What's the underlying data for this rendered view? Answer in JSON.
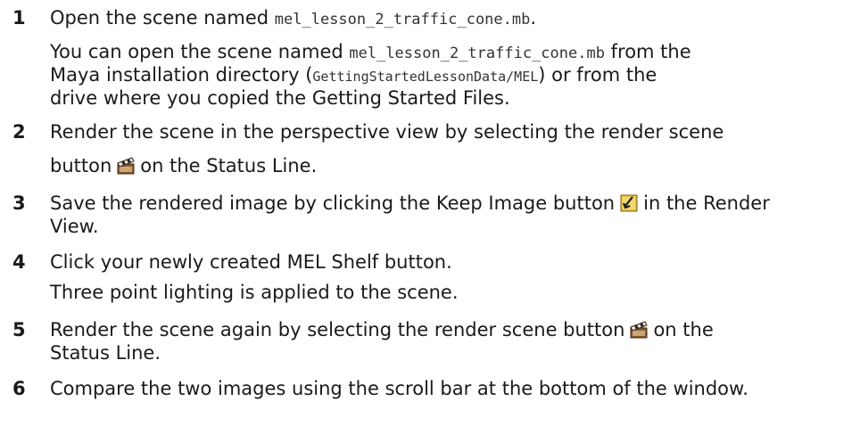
{
  "steps": [
    {
      "number": "1",
      "line1_pre": "Open the scene named ",
      "line1_code": "mel_lesson_2_traffic_cone.mb",
      "line1_post": ".",
      "p2_l1_pre": "You can open the scene named ",
      "p2_l1_code": "mel_lesson_2_traffic_cone.mb",
      "p2_l1_post": " from the",
      "p2_l2_pre": "Maya installation directory (",
      "p2_l2_code": "GettingStartedLessonData/MEL",
      "p2_l2_post": ") or from the",
      "p2_l3": "drive where you copied the Getting Started Files."
    },
    {
      "number": "2",
      "line1": "Render the scene in the perspective view by selecting the render scene",
      "line2_pre": "button",
      "line2_post": "on the Status Line.",
      "icon": "clapperboard-icon"
    },
    {
      "number": "3",
      "line1_pre": "Save the rendered image by clicking the Keep Image button",
      "line1_post": "in the Render",
      "line2": "View.",
      "icon": "keep-image-icon"
    },
    {
      "number": "4",
      "line1": "Click your newly created MEL Shelf button.",
      "line2": "Three point lighting is applied to the scene."
    },
    {
      "number": "5",
      "line1_pre": "Render the scene again by selecting the render scene button",
      "line1_post": "on the",
      "line2": "Status Line.",
      "icon": "clapperboard-icon"
    },
    {
      "number": "6",
      "line1": "Compare the two images using the scroll bar at the bottom of the window."
    }
  ]
}
